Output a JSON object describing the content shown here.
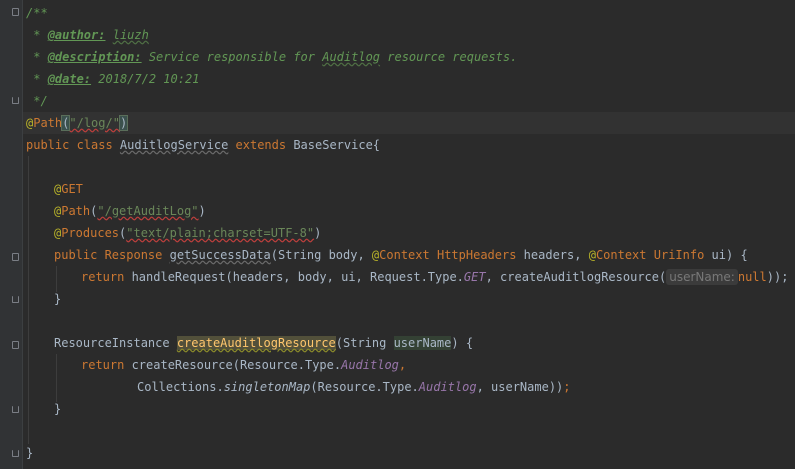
{
  "editor": {
    "lines": {
      "l1": "/**",
      "l2_star": " * ",
      "l2_tag": "@author:",
      "l2_val": "liuzh",
      "l3_star": " * ",
      "l3_tag": "@description:",
      "l3_text1": " Service responsible for ",
      "l3_word": "Auditlog",
      "l3_text2": " resource requests.",
      "l4_star": " * ",
      "l4_tag": "@date:",
      "l4_val": " 2018/7/2 10:21",
      "l5": " */",
      "l6_at": "@",
      "l6_name": "Path",
      "l6_open": "(",
      "l6_str": "\"/log/\"",
      "l6_close": ")",
      "l7_kw": "public class ",
      "l7_cls": "AuditlogService",
      "l7_ext": " extends ",
      "l7_base": "BaseService{",
      "l9_at": "@",
      "l9_name": "GET",
      "l10_at": "@",
      "l10_name": "Path",
      "l10_open": "(",
      "l10_str": "\"/getAuditLog\"",
      "l10_close": ")",
      "l11_at": "@",
      "l11_name": "Produces",
      "l11_open": "(",
      "l11_str": "\"text/plain;charset=UTF-8\"",
      "l11_close": ")",
      "l12_pub": "public ",
      "l12_resp": "Response",
      "l12_sp": " ",
      "l12_method": "getSuccessData",
      "l12_args1": "(String body, ",
      "l12_at1": "@",
      "l12_ctx1": "Context",
      "l12_sp1": " ",
      "l12_hh": "HttpHeaders",
      "l12_args2": " headers, ",
      "l12_at2": "@",
      "l12_ctx2": "Context",
      "l12_sp2": " ",
      "l12_ui": "UriInfo",
      "l12_args3": " ui) {",
      "l13_ret": "return ",
      "l13_call": "handleRequest(headers, body, ui, Request.Type.",
      "l13_get": "GET",
      "l13_mid": ", createAuditlogResource(",
      "l13_hint": "userName:",
      "l13_null": "null",
      "l13_end": "));",
      "l14": "}",
      "l16_type": "ResourceInstance ",
      "l16_method": "createAuditlogResource",
      "l16_args": "(String ",
      "l16_param": "userName",
      "l16_end": ") {",
      "l17_ret": "return ",
      "l17_call": "createResource(Resource.Type.",
      "l17_field": "Auditlog",
      "l17_comma": ",",
      "l18_call": "Collections.",
      "l18_static": "singletonMap",
      "l18_args": "(Resource.Type.",
      "l18_field": "Auditlog",
      "l18_end": ", userName))",
      "l18_semi": ";",
      "l19": "}",
      "l21": "}"
    }
  }
}
